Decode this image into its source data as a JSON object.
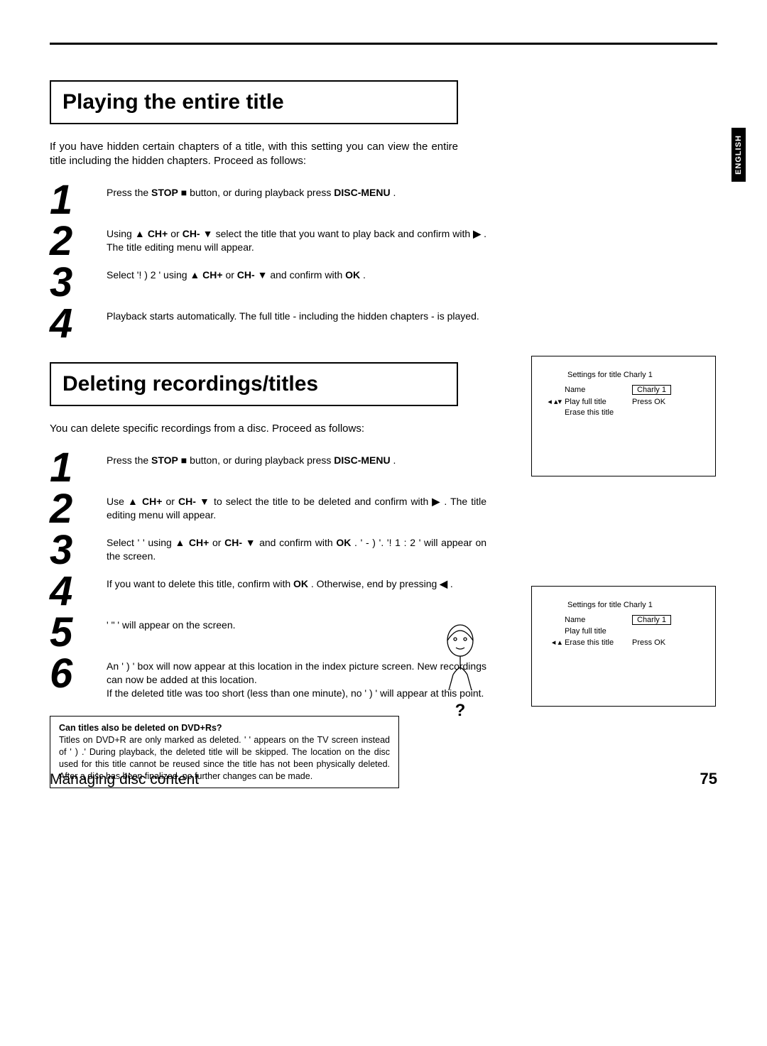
{
  "lang_tab": "ENGLISH",
  "sectionA": {
    "title": "Playing the entire title",
    "intro": "If you have hidden certain chapters of a title, with this setting you can view the entire title including the hidden chapters. Proceed as follows:",
    "steps": {
      "n1": "1",
      "s1a": "Press the ",
      "s1b": "STOP",
      "s1c": " button, or during playback press ",
      "s1d": "DISC-MENU",
      "s1e": " .",
      "n2": "2",
      "s2a": "Using ",
      "s2b": "CH+",
      "s2c": " or ",
      "s2d": "CH-",
      "s2e": " select the title that you want to play back and confirm with ",
      "s2f": " . The title editing menu will appear.",
      "n3": "3",
      "s3a": "Select '!       )   2             ' using ",
      "s3b": "CH+",
      "s3c": " or ",
      "s3d": "CH-",
      "s3e": " and confirm with ",
      "s3f": "OK",
      "s3g": " .",
      "n4": "4",
      "s4a": "Playback starts automatically. The full title - including the hidden chapters - is played."
    }
  },
  "sectionB": {
    "title": "Deleting recordings/titles",
    "intro": "You can delete specific recordings from a disc. Proceed as follows:",
    "steps": {
      "n1": "1",
      "s1a": "Press the ",
      "s1b": "STOP",
      "s1c": " button, or during playback press ",
      "s1d": "DISC-MENU",
      "s1e": " .",
      "n2": "2",
      "s2a": "Use ",
      "s2b": "CH+",
      "s2c": " or ",
      "s2d": "CH-",
      "s2e": " to select the title to be deleted and confirm with ",
      "s2f": " . The title editing menu will appear.",
      "n3": "3",
      "s3a": "Select '                              ' using ",
      "s3b": "CH+",
      "s3c": " or ",
      "s3d": "CH-",
      "s3e": " and confirm with ",
      "s3f": "OK",
      "s3g": " . '             -                       )               '. '!              1 :             2        ' will appear on the screen.",
      "n4": "4",
      "s4a": "If you want to delete this title, confirm with ",
      "s4b": "OK",
      "s4c": " . Otherwise, end by pressing ",
      "s4d": " .",
      "n5": "5",
      "s5a": "'          \"          ' will appear on the screen.",
      "n6": "6",
      "s6a": "An '          )          ' box will now appear at this location in the index picture screen. New recordings can now be added at this location.",
      "s6b": "If the deleted title was too short (less than one minute), no '          )          ' will appear at this point."
    }
  },
  "osd_play": {
    "title": "Settings for title Charly 1",
    "r1_label": "Name",
    "r1_val": "Charly 1",
    "r2_label": "Play full title",
    "r2_val": "Press OK",
    "r3_label": "Erase this title"
  },
  "osd_del": {
    "title": "Settings for title Charly 1",
    "r1_label": "Name",
    "r1_val": "Charly 1",
    "r2_label": "Play full title",
    "r3_label": "Erase this title",
    "r3_val": "Press OK"
  },
  "tip": {
    "heading": "Can titles also be deleted on DVD+Rs?",
    "body1": "Titles on DVD+R are only marked as deleted. '                   ' appears on the TV screen instead of '          )          .' During playback, the deleted title will be skipped. The location on the disc used for this title cannot be reused since the title has not been physically deleted. After a disc has been finalized, no further changes can be made.",
    "qmark": "?"
  },
  "footer": {
    "section": "Managing disc content",
    "page": "75"
  },
  "glyphs": {
    "stop": "■",
    "up": "▲",
    "down": "▼",
    "right": "▶",
    "left": "◀",
    "updown": "▴▾",
    "leftmark": "◂"
  }
}
